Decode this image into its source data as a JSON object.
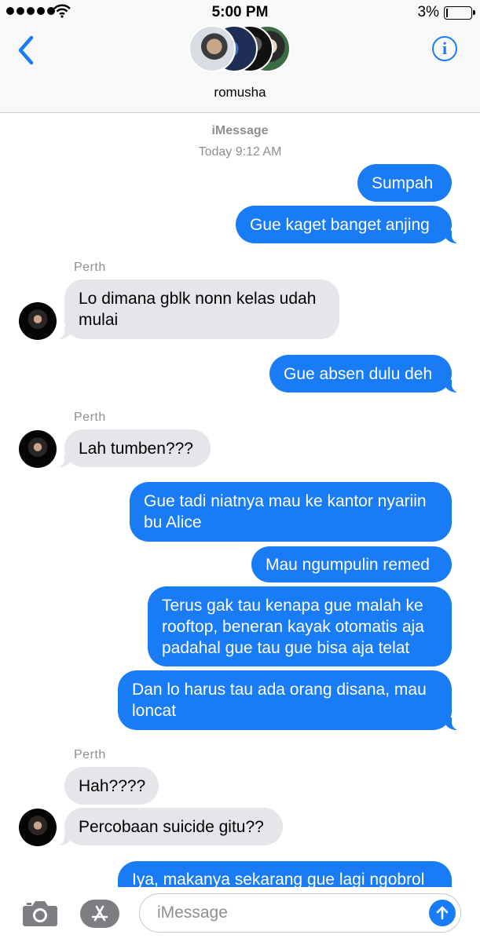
{
  "status_bar": {
    "time": "5:00 PM",
    "battery": "3%"
  },
  "header": {
    "group_name": "romusha",
    "back_icon": "chevron-left-icon",
    "info_icon": "info-icon"
  },
  "conversation": {
    "service": "iMessage",
    "timestamp": "Today 9:12 AM",
    "messages": [
      {
        "from": "me",
        "text": "Sumpah"
      },
      {
        "from": "me",
        "text": "Gue kaget banget anjing"
      },
      {
        "from": "Perth",
        "sender_label": "Perth",
        "text": "Lo dimana gblk nonn kelas udah mulai"
      },
      {
        "from": "me",
        "text": "Gue absen dulu deh"
      },
      {
        "from": "Perth",
        "sender_label": "Perth",
        "text": "Lah tumben???"
      },
      {
        "from": "me",
        "text": "Gue tadi niatnya mau ke kantor nyariin bu Alice"
      },
      {
        "from": "me",
        "text": "Mau ngumpulin remed"
      },
      {
        "from": "me",
        "text": "Terus gak tau kenapa gue malah ke rooftop, beneran kayak otomatis aja padahal gue tau gue bisa aja telat"
      },
      {
        "from": "me",
        "text": "Dan lo harus tau ada orang disana, mau loncat"
      },
      {
        "from": "Perth",
        "sender_label": "Perth",
        "text": "Hah????"
      },
      {
        "from": "Perth",
        "text": "Percobaan suicide gitu??"
      },
      {
        "from": "me",
        "text": "Iya, makanya sekarang gue lagi ngobrol"
      }
    ]
  },
  "compose": {
    "placeholder": "iMessage",
    "camera_icon": "camera-icon",
    "apps_icon": "app-store-icon",
    "send_icon": "send-arrow-icon"
  },
  "colors": {
    "accent": "#1a7cf5",
    "incoming_bubble": "#e5e5ea"
  }
}
